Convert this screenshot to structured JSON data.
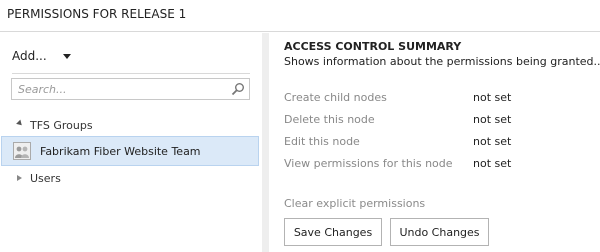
{
  "header": {
    "title": "PERMISSIONS FOR RELEASE 1"
  },
  "toolbar": {
    "add_label": "Add..."
  },
  "search": {
    "placeholder": "Search..."
  },
  "tree": {
    "group_label": "TFS Groups",
    "selected_item": "Fabrikam Fiber Website Team",
    "users_label": "Users"
  },
  "summary": {
    "title": "ACCESS CONTROL SUMMARY",
    "subtitle": "Shows information about the permissions being granted..."
  },
  "permissions": [
    {
      "name": "Create child nodes",
      "value": "not set"
    },
    {
      "name": "Delete this node",
      "value": "not set"
    },
    {
      "name": "Edit this node",
      "value": "not set"
    },
    {
      "name": "View permissions for this node",
      "value": "not set"
    }
  ],
  "actions": {
    "clear_label": "Clear explicit permissions",
    "save_label": "Save Changes",
    "undo_label": "Undo Changes"
  },
  "colors": {
    "selection_background": "#dbe9f8",
    "splitter": "#eeeeee"
  },
  "icons": [
    "search-icon",
    "group-avatar-icon",
    "dropdown-caret-icon"
  ]
}
